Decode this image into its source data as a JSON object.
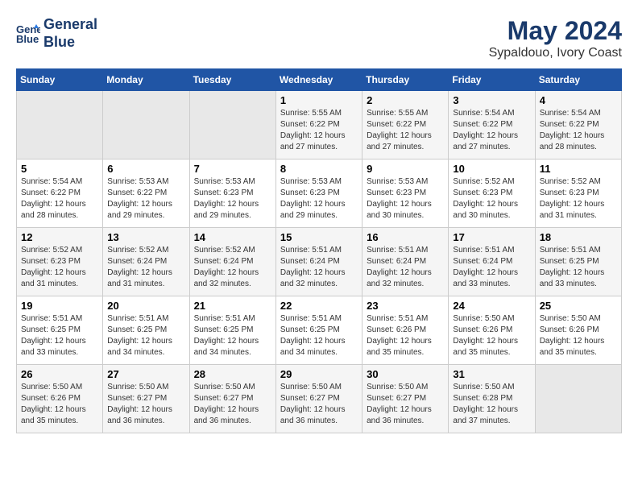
{
  "header": {
    "logo_line1": "General",
    "logo_line2": "Blue",
    "title": "May 2024",
    "subtitle": "Sypaldouo, Ivory Coast"
  },
  "calendar": {
    "days_of_week": [
      "Sunday",
      "Monday",
      "Tuesday",
      "Wednesday",
      "Thursday",
      "Friday",
      "Saturday"
    ],
    "weeks": [
      [
        {
          "day": "",
          "info": ""
        },
        {
          "day": "",
          "info": ""
        },
        {
          "day": "",
          "info": ""
        },
        {
          "day": "1",
          "sunrise": "Sunrise: 5:55 AM",
          "sunset": "Sunset: 6:22 PM",
          "daylight": "Daylight: 12 hours and 27 minutes."
        },
        {
          "day": "2",
          "sunrise": "Sunrise: 5:55 AM",
          "sunset": "Sunset: 6:22 PM",
          "daylight": "Daylight: 12 hours and 27 minutes."
        },
        {
          "day": "3",
          "sunrise": "Sunrise: 5:54 AM",
          "sunset": "Sunset: 6:22 PM",
          "daylight": "Daylight: 12 hours and 27 minutes."
        },
        {
          "day": "4",
          "sunrise": "Sunrise: 5:54 AM",
          "sunset": "Sunset: 6:22 PM",
          "daylight": "Daylight: 12 hours and 28 minutes."
        }
      ],
      [
        {
          "day": "5",
          "sunrise": "Sunrise: 5:54 AM",
          "sunset": "Sunset: 6:22 PM",
          "daylight": "Daylight: 12 hours and 28 minutes."
        },
        {
          "day": "6",
          "sunrise": "Sunrise: 5:53 AM",
          "sunset": "Sunset: 6:22 PM",
          "daylight": "Daylight: 12 hours and 29 minutes."
        },
        {
          "day": "7",
          "sunrise": "Sunrise: 5:53 AM",
          "sunset": "Sunset: 6:23 PM",
          "daylight": "Daylight: 12 hours and 29 minutes."
        },
        {
          "day": "8",
          "sunrise": "Sunrise: 5:53 AM",
          "sunset": "Sunset: 6:23 PM",
          "daylight": "Daylight: 12 hours and 29 minutes."
        },
        {
          "day": "9",
          "sunrise": "Sunrise: 5:53 AM",
          "sunset": "Sunset: 6:23 PM",
          "daylight": "Daylight: 12 hours and 30 minutes."
        },
        {
          "day": "10",
          "sunrise": "Sunrise: 5:52 AM",
          "sunset": "Sunset: 6:23 PM",
          "daylight": "Daylight: 12 hours and 30 minutes."
        },
        {
          "day": "11",
          "sunrise": "Sunrise: 5:52 AM",
          "sunset": "Sunset: 6:23 PM",
          "daylight": "Daylight: 12 hours and 31 minutes."
        }
      ],
      [
        {
          "day": "12",
          "sunrise": "Sunrise: 5:52 AM",
          "sunset": "Sunset: 6:23 PM",
          "daylight": "Daylight: 12 hours and 31 minutes."
        },
        {
          "day": "13",
          "sunrise": "Sunrise: 5:52 AM",
          "sunset": "Sunset: 6:24 PM",
          "daylight": "Daylight: 12 hours and 31 minutes."
        },
        {
          "day": "14",
          "sunrise": "Sunrise: 5:52 AM",
          "sunset": "Sunset: 6:24 PM",
          "daylight": "Daylight: 12 hours and 32 minutes."
        },
        {
          "day": "15",
          "sunrise": "Sunrise: 5:51 AM",
          "sunset": "Sunset: 6:24 PM",
          "daylight": "Daylight: 12 hours and 32 minutes."
        },
        {
          "day": "16",
          "sunrise": "Sunrise: 5:51 AM",
          "sunset": "Sunset: 6:24 PM",
          "daylight": "Daylight: 12 hours and 32 minutes."
        },
        {
          "day": "17",
          "sunrise": "Sunrise: 5:51 AM",
          "sunset": "Sunset: 6:24 PM",
          "daylight": "Daylight: 12 hours and 33 minutes."
        },
        {
          "day": "18",
          "sunrise": "Sunrise: 5:51 AM",
          "sunset": "Sunset: 6:25 PM",
          "daylight": "Daylight: 12 hours and 33 minutes."
        }
      ],
      [
        {
          "day": "19",
          "sunrise": "Sunrise: 5:51 AM",
          "sunset": "Sunset: 6:25 PM",
          "daylight": "Daylight: 12 hours and 33 minutes."
        },
        {
          "day": "20",
          "sunrise": "Sunrise: 5:51 AM",
          "sunset": "Sunset: 6:25 PM",
          "daylight": "Daylight: 12 hours and 34 minutes."
        },
        {
          "day": "21",
          "sunrise": "Sunrise: 5:51 AM",
          "sunset": "Sunset: 6:25 PM",
          "daylight": "Daylight: 12 hours and 34 minutes."
        },
        {
          "day": "22",
          "sunrise": "Sunrise: 5:51 AM",
          "sunset": "Sunset: 6:25 PM",
          "daylight": "Daylight: 12 hours and 34 minutes."
        },
        {
          "day": "23",
          "sunrise": "Sunrise: 5:51 AM",
          "sunset": "Sunset: 6:26 PM",
          "daylight": "Daylight: 12 hours and 35 minutes."
        },
        {
          "day": "24",
          "sunrise": "Sunrise: 5:50 AM",
          "sunset": "Sunset: 6:26 PM",
          "daylight": "Daylight: 12 hours and 35 minutes."
        },
        {
          "day": "25",
          "sunrise": "Sunrise: 5:50 AM",
          "sunset": "Sunset: 6:26 PM",
          "daylight": "Daylight: 12 hours and 35 minutes."
        }
      ],
      [
        {
          "day": "26",
          "sunrise": "Sunrise: 5:50 AM",
          "sunset": "Sunset: 6:26 PM",
          "daylight": "Daylight: 12 hours and 35 minutes."
        },
        {
          "day": "27",
          "sunrise": "Sunrise: 5:50 AM",
          "sunset": "Sunset: 6:27 PM",
          "daylight": "Daylight: 12 hours and 36 minutes."
        },
        {
          "day": "28",
          "sunrise": "Sunrise: 5:50 AM",
          "sunset": "Sunset: 6:27 PM",
          "daylight": "Daylight: 12 hours and 36 minutes."
        },
        {
          "day": "29",
          "sunrise": "Sunrise: 5:50 AM",
          "sunset": "Sunset: 6:27 PM",
          "daylight": "Daylight: 12 hours and 36 minutes."
        },
        {
          "day": "30",
          "sunrise": "Sunrise: 5:50 AM",
          "sunset": "Sunset: 6:27 PM",
          "daylight": "Daylight: 12 hours and 36 minutes."
        },
        {
          "day": "31",
          "sunrise": "Sunrise: 5:50 AM",
          "sunset": "Sunset: 6:28 PM",
          "daylight": "Daylight: 12 hours and 37 minutes."
        },
        {
          "day": "",
          "info": ""
        }
      ]
    ]
  }
}
